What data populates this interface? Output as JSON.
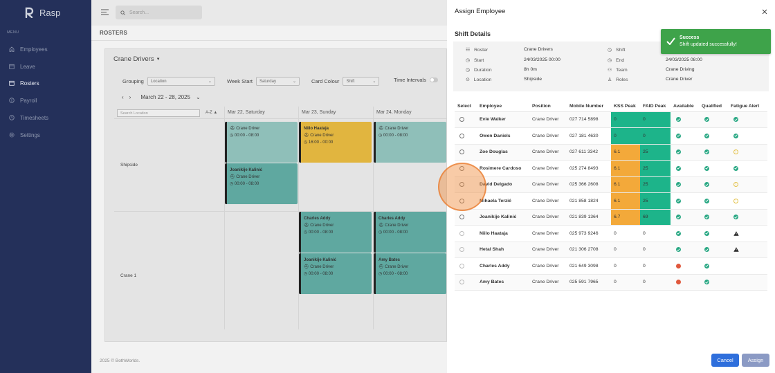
{
  "app": {
    "name": "Rasp"
  },
  "sidebar": {
    "menu_heading": "MENU",
    "items": [
      {
        "label": "Employees",
        "icon": "home-icon"
      },
      {
        "label": "Leave",
        "icon": "calendar-icon"
      },
      {
        "label": "Rosters",
        "icon": "calendar-icon",
        "active": true
      },
      {
        "label": "Payroll",
        "icon": "dollar-icon"
      },
      {
        "label": "Timesheets",
        "icon": "clock-icon"
      },
      {
        "label": "Settings",
        "icon": "gear-icon"
      }
    ]
  },
  "topbar": {
    "search_placeholder": "Search..."
  },
  "page": {
    "title": "ROSTERS",
    "footer": "2025 © BothWorlds."
  },
  "roster": {
    "title": "Crane Drivers",
    "filters": {
      "grouping_label": "Grouping",
      "grouping_value": "Location",
      "week_start_label": "Week Start",
      "week_start_value": "Saturday",
      "card_colour_label": "Card Colour",
      "card_colour_value": "Shift",
      "time_intervals_label": "Time Intervals"
    },
    "week_range": "March 22 - 28, 2025",
    "search_location_placeholder": "Search Location",
    "sort_label": "A-Z ▲",
    "days": [
      "Mar 22, Saturday",
      "Mar 23, Sunday",
      "Mar 24, Monday"
    ],
    "rows": [
      "Shipside",
      "Crane 1"
    ],
    "shifts": [
      {
        "name": "",
        "role": "Crane Driver",
        "time": "00:00 - 08:00"
      },
      {
        "name": "Niilo Haataja",
        "role": "Crane Driver",
        "time": "16:00 - 00:00"
      },
      {
        "name": "",
        "role": "Crane Driver",
        "time": "00:00 - 08:00"
      },
      {
        "name": "Joanikije Kalinić",
        "role": "Crane Driver",
        "time": "00:00 - 08:00"
      },
      {
        "name": "Charles Addy",
        "role": "Crane Driver",
        "time": "00:00 - 08:00"
      },
      {
        "name": "Charles Addy",
        "role": "Crane Driver",
        "time": "00:00 - 08:00"
      },
      {
        "name": "Joanikije Kalinić",
        "role": "Crane Driver",
        "time": "00:00 - 08:00"
      },
      {
        "name": "Amy Bates",
        "role": "Crane Driver",
        "time": "00:00 - 08:00"
      }
    ]
  },
  "panel": {
    "title": "Assign Employee",
    "section_title": "Shift Details",
    "details": {
      "roster_label": "Roster",
      "roster_value": "Crane Drivers",
      "start_label": "Start",
      "start_value": "24/03/2025 00:00",
      "duration_label": "Duration",
      "duration_value": "8h 0m",
      "location_label": "Location",
      "location_value": "Shipside",
      "shift_label": "Shift",
      "shift_value": "",
      "end_label": "End",
      "end_value": "24/03/2025 08:00",
      "team_label": "Team",
      "team_value": "Crane Driving",
      "roles_label": "Roles",
      "roles_value": "Crane Driver"
    },
    "columns": [
      "Select",
      "Employee",
      "Position",
      "Mobile Number",
      "KSS Peak",
      "FAID Peak",
      "Available",
      "Qualified",
      "Fatigue Alert"
    ],
    "employees": [
      {
        "name": "Evie Walker",
        "position": "Crane Driver",
        "mobile": "027 714 5898",
        "kss": "0",
        "faid": "0",
        "kss_color": "#1db48a",
        "faid_color": "#1db48a",
        "available": "ok",
        "qualified": "ok",
        "fatigue": "ok"
      },
      {
        "name": "Owen Daniels",
        "position": "Crane Driver",
        "mobile": "027 181 4630",
        "kss": "0",
        "faid": "0",
        "kss_color": "#1db48a",
        "faid_color": "#1db48a",
        "available": "ok",
        "qualified": "ok",
        "fatigue": "ok"
      },
      {
        "name": "Zoe Douglas",
        "position": "Crane Driver",
        "mobile": "027 611 3342",
        "kss": "6.1",
        "faid": "25",
        "kss_color": "#f3a93a",
        "faid_color": "#1db48a",
        "available": "ok",
        "qualified": "ok",
        "fatigue": "warn"
      },
      {
        "name": "Rosimere Cardoso",
        "position": "Crane Driver",
        "mobile": "025 274 8493",
        "kss": "6.1",
        "faid": "25",
        "kss_color": "#f3a93a",
        "faid_color": "#1db48a",
        "available": "ok",
        "qualified": "ok",
        "fatigue": "ok"
      },
      {
        "name": "David Delgado",
        "position": "Crane Driver",
        "mobile": "025 366 2608",
        "kss": "6.1",
        "faid": "25",
        "kss_color": "#f3a93a",
        "faid_color": "#1db48a",
        "available": "ok",
        "qualified": "ok",
        "fatigue": "warn"
      },
      {
        "name": "Mihaela Terzić",
        "position": "Crane Driver",
        "mobile": "021 858 1824",
        "kss": "6.1",
        "faid": "25",
        "kss_color": "#f3a93a",
        "faid_color": "#1db48a",
        "available": "ok",
        "qualified": "ok",
        "fatigue": "warn"
      },
      {
        "name": "Joanikije Kalinić",
        "position": "Crane Driver",
        "mobile": "021 839 1364",
        "kss": "6.7",
        "faid": "69",
        "kss_color": "#f3a93a",
        "faid_color": "#1db48a",
        "available": "ok",
        "qualified": "ok",
        "fatigue": "ok"
      },
      {
        "name": "Niilo Haataja",
        "position": "Crane Driver",
        "mobile": "025 973 9246",
        "kss": "0",
        "faid": "0",
        "kss_color": "",
        "faid_color": "",
        "available": "ok",
        "qualified": "ok",
        "fatigue": "alert"
      },
      {
        "name": "Hetal Shah",
        "position": "Crane Driver",
        "mobile": "021 306 2708",
        "kss": "0",
        "faid": "0",
        "kss_color": "",
        "faid_color": "",
        "available": "ok",
        "qualified": "ok",
        "fatigue": "alert"
      },
      {
        "name": "Charles Addy",
        "position": "Crane Driver",
        "mobile": "021 649 3098",
        "kss": "0",
        "faid": "0",
        "kss_color": "",
        "faid_color": "",
        "available": "bad",
        "qualified": "ok",
        "fatigue": "none"
      },
      {
        "name": "Amy Bates",
        "position": "Crane Driver",
        "mobile": "025 591 7965",
        "kss": "0",
        "faid": "0",
        "kss_color": "",
        "faid_color": "",
        "available": "bad",
        "qualified": "ok",
        "fatigue": "none"
      }
    ],
    "cancel_label": "Cancel",
    "assign_label": "Assign"
  },
  "toast": {
    "title": "Success",
    "message": "Shift updated successfully!"
  },
  "colors": {
    "sidebar": "#24305a",
    "teal": "#5fa8a0",
    "yellow": "#e1b53f",
    "green": "#1db48a",
    "orange": "#f3a93a",
    "cancel": "#2f6fdc",
    "assign": "#8b9ac4",
    "toast": "#3ea34a"
  }
}
